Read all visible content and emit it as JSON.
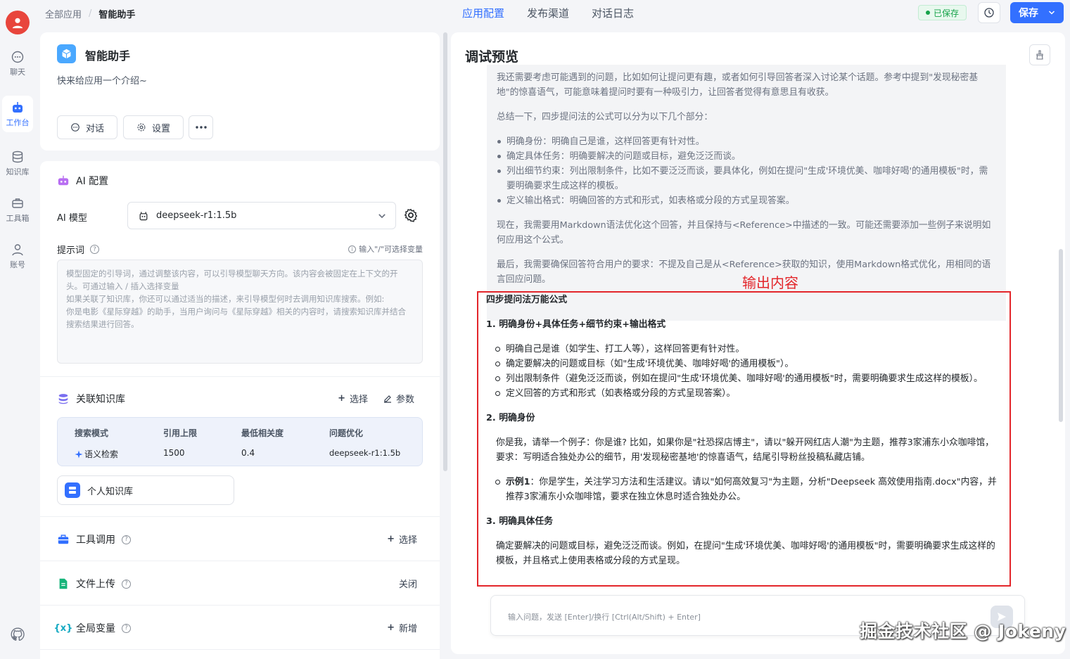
{
  "rail": {
    "items": [
      {
        "label": "聊天",
        "icon": "chat-bubble-icon"
      },
      {
        "label": "工作台",
        "icon": "robot-icon"
      },
      {
        "label": "知识库",
        "icon": "database-icon"
      },
      {
        "label": "工具箱",
        "icon": "toolbox-icon"
      },
      {
        "label": "账号",
        "icon": "user-icon"
      }
    ],
    "github_icon": "github-icon"
  },
  "breadcrumb": {
    "root": "全部应用",
    "current": "智能助手"
  },
  "nav_tabs": [
    {
      "label": "应用配置",
      "active": true
    },
    {
      "label": "发布渠道",
      "active": false
    },
    {
      "label": "对话日志",
      "active": false
    }
  ],
  "header": {
    "saved_status": "已保存",
    "save_label": "保存"
  },
  "app": {
    "name": "智能助手",
    "intro": "快来给应用一个介绍~",
    "chat_button": "对话",
    "settings_button": "设置"
  },
  "ai_config": {
    "title": "AI 配置",
    "model_label": "AI 模型",
    "model_value": "deepseek-r1:1.5b",
    "prompt_label": "提示词",
    "prompt_hint": "输入\"/\"可选择变量",
    "prompt_placeholder": "模型固定的引导词，通过调整该内容，可以引导模型聊天方向。该内容会被固定在上下文的开头。可通过输入 / 插入选择变量\n如果关联了知识库，你还可以通过适当的描述，来引导模型何时去调用知识库搜索。例如:\n你是电影《星际穿越》的助手，当用户询问与《星际穿越》相关的内容时，请搜索知识库并结合搜索结果进行回答。"
  },
  "knowledge": {
    "title": "关联知识库",
    "select_label": "选择",
    "params_label": "参数",
    "table_headers": [
      "搜索模式",
      "引用上限",
      "最低相关度",
      "问题优化"
    ],
    "table_values": [
      "语义检索",
      "1500",
      "0.4",
      "deepseek-r1:1.5b"
    ],
    "item_name": "个人知识库"
  },
  "tools": {
    "title": "工具调用",
    "action": "选择"
  },
  "file_upload": {
    "title": "文件上传",
    "action": "关闭"
  },
  "global_vars": {
    "title": "全局变量",
    "action": "新增"
  },
  "preview": {
    "title": "调试预览",
    "thinking": {
      "p1": "我还需要考虑可能遇到的问题，比如如何让提问更有趣，或者如何引导回答者深入讨论某个话题。参考中提到\"发现秘密基地\"的惊喜语气，可能意味着提问时要有一种吸引力，让回答者觉得有意思且有收获。",
      "p2": "总结一下，四步提问法的公式可以分为以下几个部分：",
      "bullets": [
        "明确身份：明确自己是谁，这样回答更有针对性。",
        "确定具体任务：明确要解决的问题或目标，避免泛泛而谈。",
        "列出细节约束：列出限制条件，比如不要泛泛而谈，要具体化，例如在提问\"生成'环境优美、咖啡好喝'的通用模板\"时，需要明确要求生成这样的模板。",
        "定义输出格式：明确回答的方式和形式，如表格或分段的方式呈现答案。"
      ],
      "p3": "现在，我需要用Markdown语法优化这个回答，并且保持与<Reference>中描述的一致。可能还需要添加一些例子来说明如何应用这个公式。",
      "p4": "最后，我需要确保回答符合用户的要求：不提及自己是从<Reference>获取的知识，使用Markdown格式优化，用相同的语言回应问题。"
    },
    "output_label": "输出内容",
    "answer": {
      "heading": "四步提问法万能公式",
      "s1_title": "1. 明确身份+具体任务+细节约束+输出格式",
      "s1_bullets": [
        "明确自己是谁（如学生、打工人等），这样回答更有针对性。",
        "确定要解决的问题或目标（如\"生成'环境优美、咖啡好喝'的通用模板\"）。",
        "列出限制条件（避免泛泛而谈，例如在提问\"生成'环境优美、咖啡好喝'的通用模板\"时，需要明确要求生成这样的模板）。",
        "定义回答的方式和形式（如表格或分段的方式呈现答案）。"
      ],
      "s2_title": "2. 明确身份",
      "s2_text": "你是我，请举一个例子：你是谁? 比如，如果你是\"社恐探店博主\"，请以\"躲开网红店人潮\"为主题，推荐3家浦东小众咖啡馆，要求：写明适合独处办公的细节，用'发现秘密基地'的惊喜语气，结尾引导粉丝投稿私藏店铺。",
      "s2_example_label": "示例1",
      "s2_example_text": "：你是学生，关注学习方法和生活建议。请以\"如何高效复习\"为主题，分析\"Deepseek 高效使用指南.docx\"内容，并推荐3家浦东小众咖啡馆，要求在独立休息时适合独处办公。",
      "s3_title": "3. 明确具体任务",
      "s3_text": "确定要解决的问题或目标，避免泛泛而谈。例如，在提问\"生成'环境优美、咖啡好喝'的通用模板\"时，需要明确要求生成这样的模板，并且格式上使用表格或分段的方式呈现。"
    },
    "input_placeholder": "输入问题，发送 [Enter]/换行 [Ctrl(Alt/Shift) + Enter]"
  },
  "watermark": "掘金技术社区 @ Jokeny",
  "colors": {
    "primary": "#3370ff",
    "annotation_red": "#e3262b",
    "saved_green": "#16a34a"
  }
}
